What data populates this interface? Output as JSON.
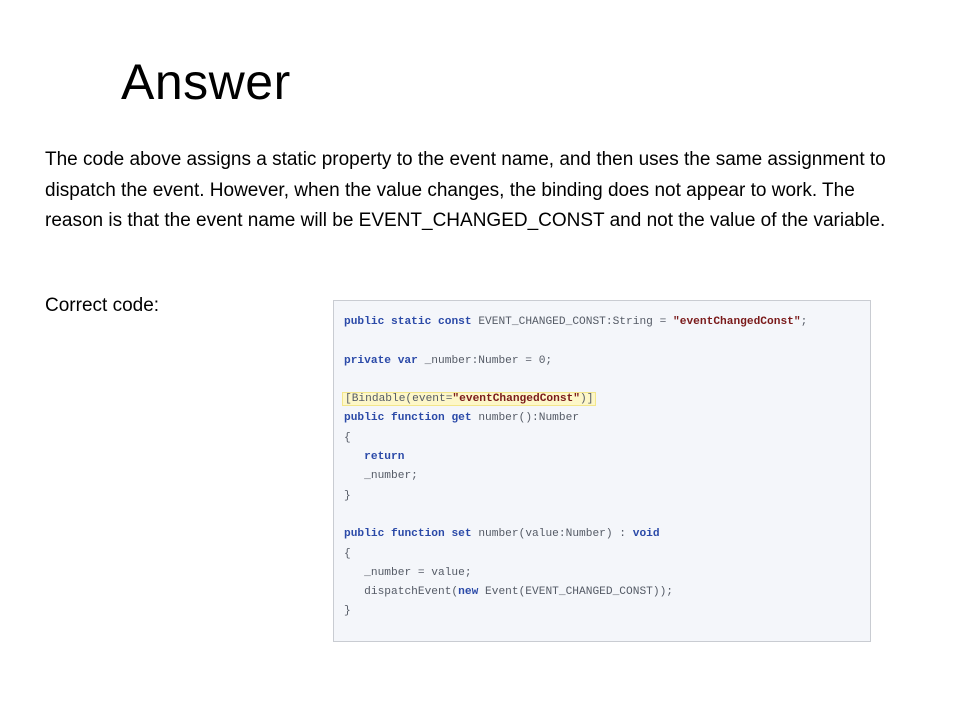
{
  "slide": {
    "title": "Answer",
    "paragraph": "The code above assigns a static property to the event name, and then uses the same assignment to dispatch the event. However, when the value changes, the binding does not appear to work.  The reason is that the event name will be EVENT_CHANGED_CONST and not the value of the variable.",
    "correct_label": "Correct code:"
  },
  "code": {
    "l1": {
      "k1": "public",
      "k2": "static",
      "k3": "const",
      "t1": " EVENT_CHANGED_CONST:String = ",
      "s1": "\"eventChangedConst\"",
      "t2": ";"
    },
    "l3": {
      "k1": "private",
      "k2": "var",
      "t1": " _number:Number = 0;"
    },
    "l5": {
      "t1": "[Bindable(event=",
      "s1": "\"eventChangedConst\"",
      "t2": ")]"
    },
    "l6": {
      "k1": "public",
      "k2": "function",
      "k3": "get",
      "t1": " number():Number"
    },
    "l7": {
      "t1": "{"
    },
    "l8": {
      "k1": "return"
    },
    "l9": {
      "t1": "_number;"
    },
    "l10": {
      "t1": "}"
    },
    "l12": {
      "k1": "public",
      "k2": "function",
      "k3": "set",
      "t1": " number(value:Number) : ",
      "k4": "void"
    },
    "l13": {
      "t1": "{"
    },
    "l14": {
      "t1": "_number = value;"
    },
    "l15": {
      "t1": "dispatchEvent(",
      "k1": "new",
      "t2": " Event(EVENT_CHANGED_CONST));"
    },
    "l16": {
      "t1": "}"
    }
  }
}
